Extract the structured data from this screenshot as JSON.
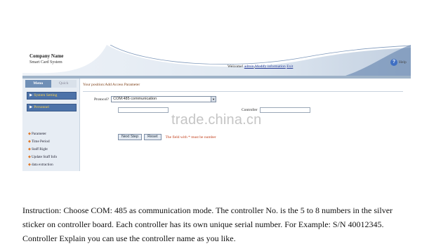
{
  "header": {
    "company_name": "Company Name",
    "system_name": "Smart Card System",
    "welcome_prefix": "Welcome!",
    "user": "admin",
    "separator": ",",
    "modify_link": "Modify information",
    "exit_link": "Exit",
    "help_label": "Help"
  },
  "sidebar": {
    "tabs": [
      {
        "label": "Menu",
        "active": true
      },
      {
        "label": "Quick",
        "active": false
      }
    ],
    "buttons": [
      {
        "label": "System Setting"
      },
      {
        "label": "Personnel"
      }
    ],
    "items": [
      {
        "label": "Parameter"
      },
      {
        "label": "Time Period"
      },
      {
        "label": "Staff Right"
      },
      {
        "label": "Update Staff Info"
      },
      {
        "label": "data extraction"
      }
    ]
  },
  "main": {
    "breadcrumb": "Your position:Add Access Parameter",
    "protocol_label": "Protocol?",
    "protocol_value": "COM:485 communication",
    "controller_label": "Controller",
    "buttons": {
      "next": "Next Step",
      "reset": "Reset"
    },
    "note": "The field with * must be number"
  },
  "watermark": "trade.china.cn",
  "instruction": "Instruction: Choose COM: 485 as communication mode. The controller No. is the 5 to 8 numbers in the silver sticker on controller board. Each controller has its own unique serial number. For Example: S/N 40012345. Controller Explain you can use the controller name as you like.",
  "colors": {
    "header_strip": "#9fb3c8",
    "sidebar_bg": "#e7edf4",
    "sidebar_button": "#4c72a8",
    "breadcrumb": "#7a3a10",
    "note": "#c03b16",
    "link": "#2a3e9a"
  },
  "icons": {
    "help": "help-icon",
    "sidebar_button": "right-arrow-icon",
    "list_bullet": "bullet-icon",
    "select_dropdown": "chevron-down-icon"
  }
}
